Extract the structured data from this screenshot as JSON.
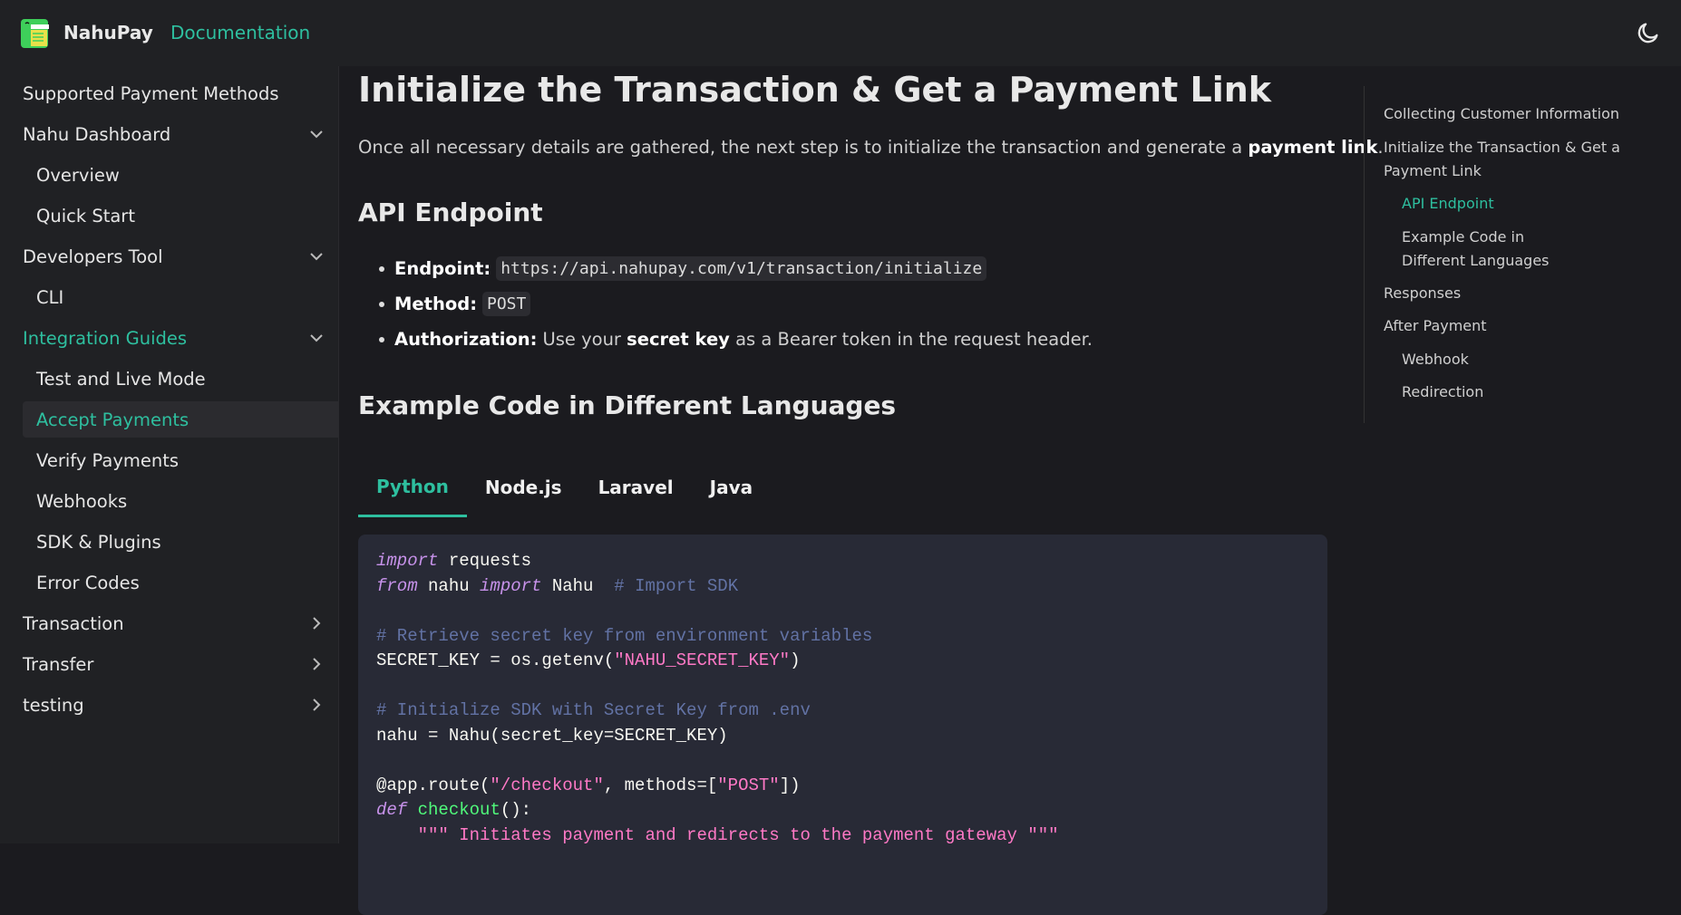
{
  "header": {
    "brand": "NahuPay",
    "nav_link": "Documentation",
    "theme_icon": "moon-icon"
  },
  "sidebar": {
    "items": [
      {
        "label": "Supported Payment Methods"
      },
      {
        "label": "Nahu Dashboard",
        "chevron": "down"
      },
      {
        "label": "Overview"
      },
      {
        "label": "Quick Start"
      },
      {
        "label": "Developers Tool",
        "chevron": "down"
      },
      {
        "label": "CLI"
      },
      {
        "label": "Integration Guides",
        "chevron": "down"
      },
      {
        "label": "Test and Live Mode"
      },
      {
        "label": "Accept Payments"
      },
      {
        "label": "Verify Payments"
      },
      {
        "label": "Webhooks"
      },
      {
        "label": "SDK & Plugins"
      },
      {
        "label": "Error Codes"
      },
      {
        "label": "Transaction",
        "chevron": "right"
      },
      {
        "label": "Transfer",
        "chevron": "right"
      },
      {
        "label": "testing",
        "chevron": "right"
      }
    ]
  },
  "main": {
    "title": "Initialize the Transaction & Get a Payment Link",
    "intro": "Once all necessary details are gathered, the next step is to initialize the transaction and generate a ",
    "intro_bold": "payment link",
    "intro_end": ".",
    "api_heading": "API Endpoint",
    "endpoint_label": "Endpoint:",
    "endpoint_value": "https://api.nahupay.com/v1/transaction/initialize",
    "method_label": "Method:",
    "method_value": "POST",
    "auth_label": "Authorization:",
    "auth_pre": "Use your ",
    "auth_bold": "secret key",
    "auth_post": " as a Bearer token in the request header.",
    "examples_heading": "Example Code in Different Languages",
    "tabs": [
      "Python",
      "Node.js",
      "Laravel",
      "Java"
    ],
    "code": {
      "l1": [
        "import",
        " requests"
      ],
      "l2": [
        "from",
        " nahu ",
        "import",
        " Nahu  ",
        "# Import SDK"
      ],
      "l4": "# Retrieve secret key from environment variables",
      "l5": [
        "SECRET_KEY = os.getenv(",
        "\"NAHU_SECRET_KEY\"",
        ")"
      ],
      "l7": "# Initialize SDK with Secret Key from .env",
      "l8": "nahu = Nahu(secret_key=SECRET_KEY)",
      "l10": [
        "@app.route(",
        "\"/checkout\"",
        ", methods=[",
        "\"POST\"",
        "])"
      ],
      "l11": [
        "def",
        " ",
        "checkout",
        "():"
      ],
      "l12": "    \"\"\" Initiates payment and redirects to the payment gateway \"\"\""
    }
  },
  "toc": {
    "items": [
      "Collecting Customer Information",
      "Initialize the Transaction & Get a Payment Link",
      "API Endpoint",
      "Example Code in Different Languages",
      "Responses",
      "After Payment",
      "Webhook",
      "Redirection"
    ]
  },
  "colors": {
    "accent": "#2ebf9f",
    "background": "#1b1b1f",
    "code_bg": "#282a36"
  }
}
